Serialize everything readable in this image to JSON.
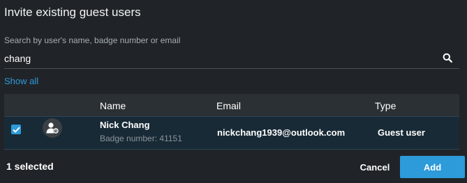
{
  "dialog": {
    "title": "Invite existing guest users"
  },
  "search": {
    "label": "Search by user's name, badge number or email",
    "value": "chang",
    "placeholder": "",
    "icon": "search-icon"
  },
  "show_all_label": "Show all",
  "table": {
    "headers": {
      "name": "Name",
      "email": "Email",
      "type": "Type"
    },
    "rows": [
      {
        "checked": true,
        "avatar_icon": "guest-user-icon",
        "name": "Nick Chang",
        "badge": "Badge number: 41151",
        "email": "nickchang1939@outlook.com",
        "type": "Guest user"
      }
    ]
  },
  "footer": {
    "selected_count": "1 selected",
    "cancel_label": "Cancel",
    "add_label": "Add"
  },
  "colors": {
    "background": "#202428",
    "accent": "#2d9ad9",
    "header_row": "#2b3035",
    "selected_row": "#182a36"
  }
}
